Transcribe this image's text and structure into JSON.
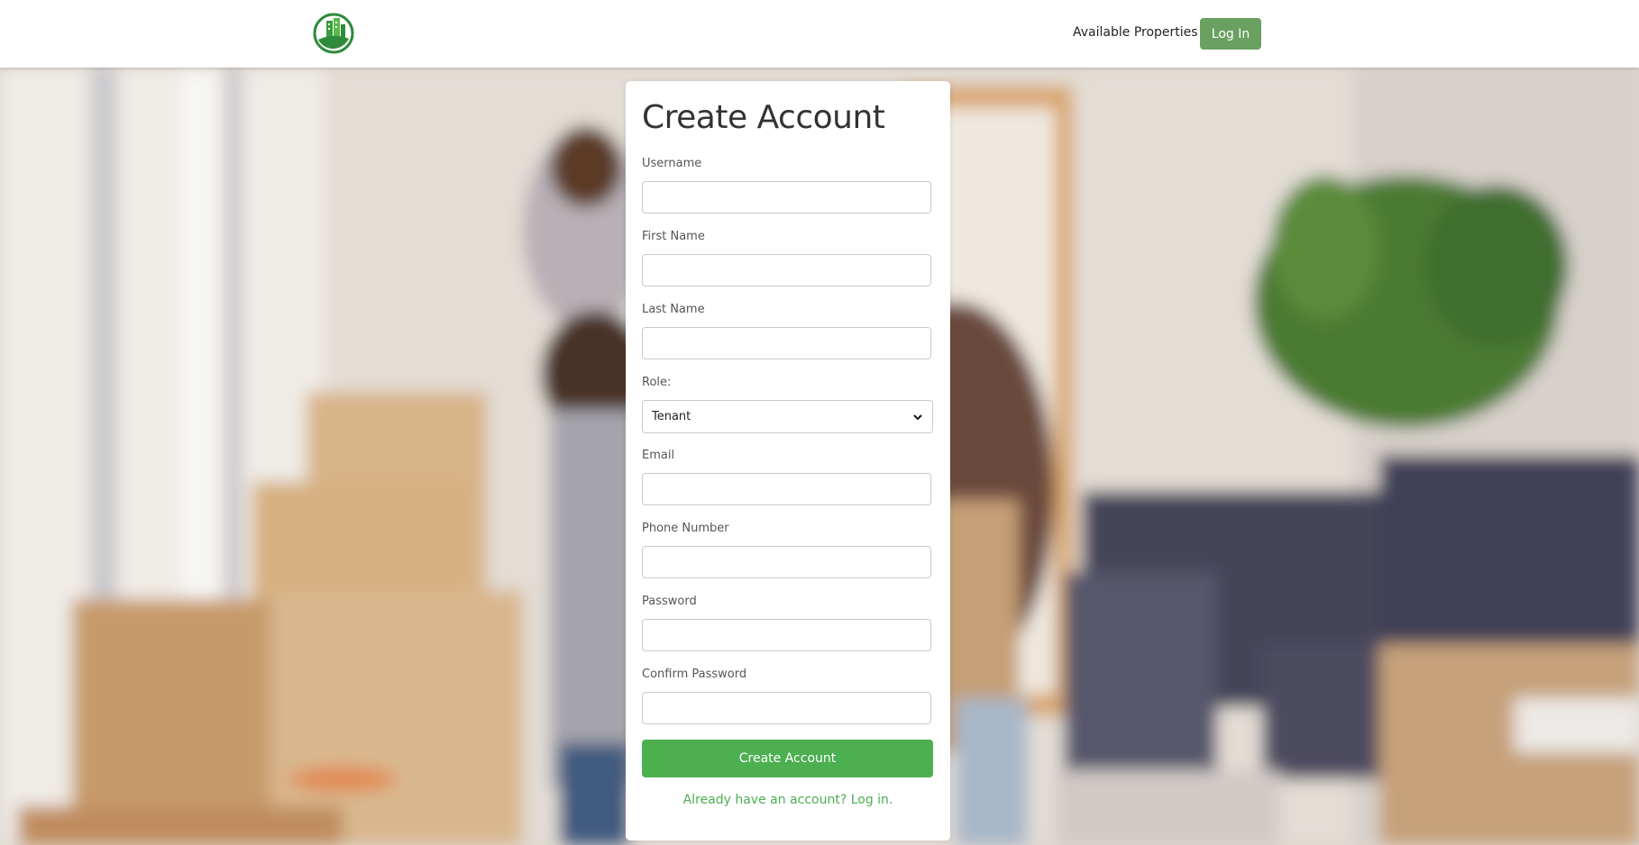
{
  "header": {
    "available_properties_label": "Available Properties",
    "login_label": "Log In"
  },
  "form": {
    "title": "Create Account",
    "fields": [
      {
        "label": "Username",
        "value": ""
      },
      {
        "label": "First Name",
        "value": ""
      },
      {
        "label": "Last Name",
        "value": ""
      },
      {
        "label": "Role:",
        "value": "Tenant"
      },
      {
        "label": "Email",
        "value": ""
      },
      {
        "label": "Phone Number",
        "value": ""
      },
      {
        "label": "Password",
        "value": ""
      },
      {
        "label": "Confirm Password",
        "value": ""
      }
    ],
    "submit_label": "Create Account",
    "login_prompt": "Already have an account? Log in."
  },
  "colors": {
    "accent": "#4caf50",
    "login_button": "#6aa060",
    "logo_green": "#2e8b3a"
  },
  "icons": [
    "building-logo-icon",
    "chevron-down-icon"
  ]
}
